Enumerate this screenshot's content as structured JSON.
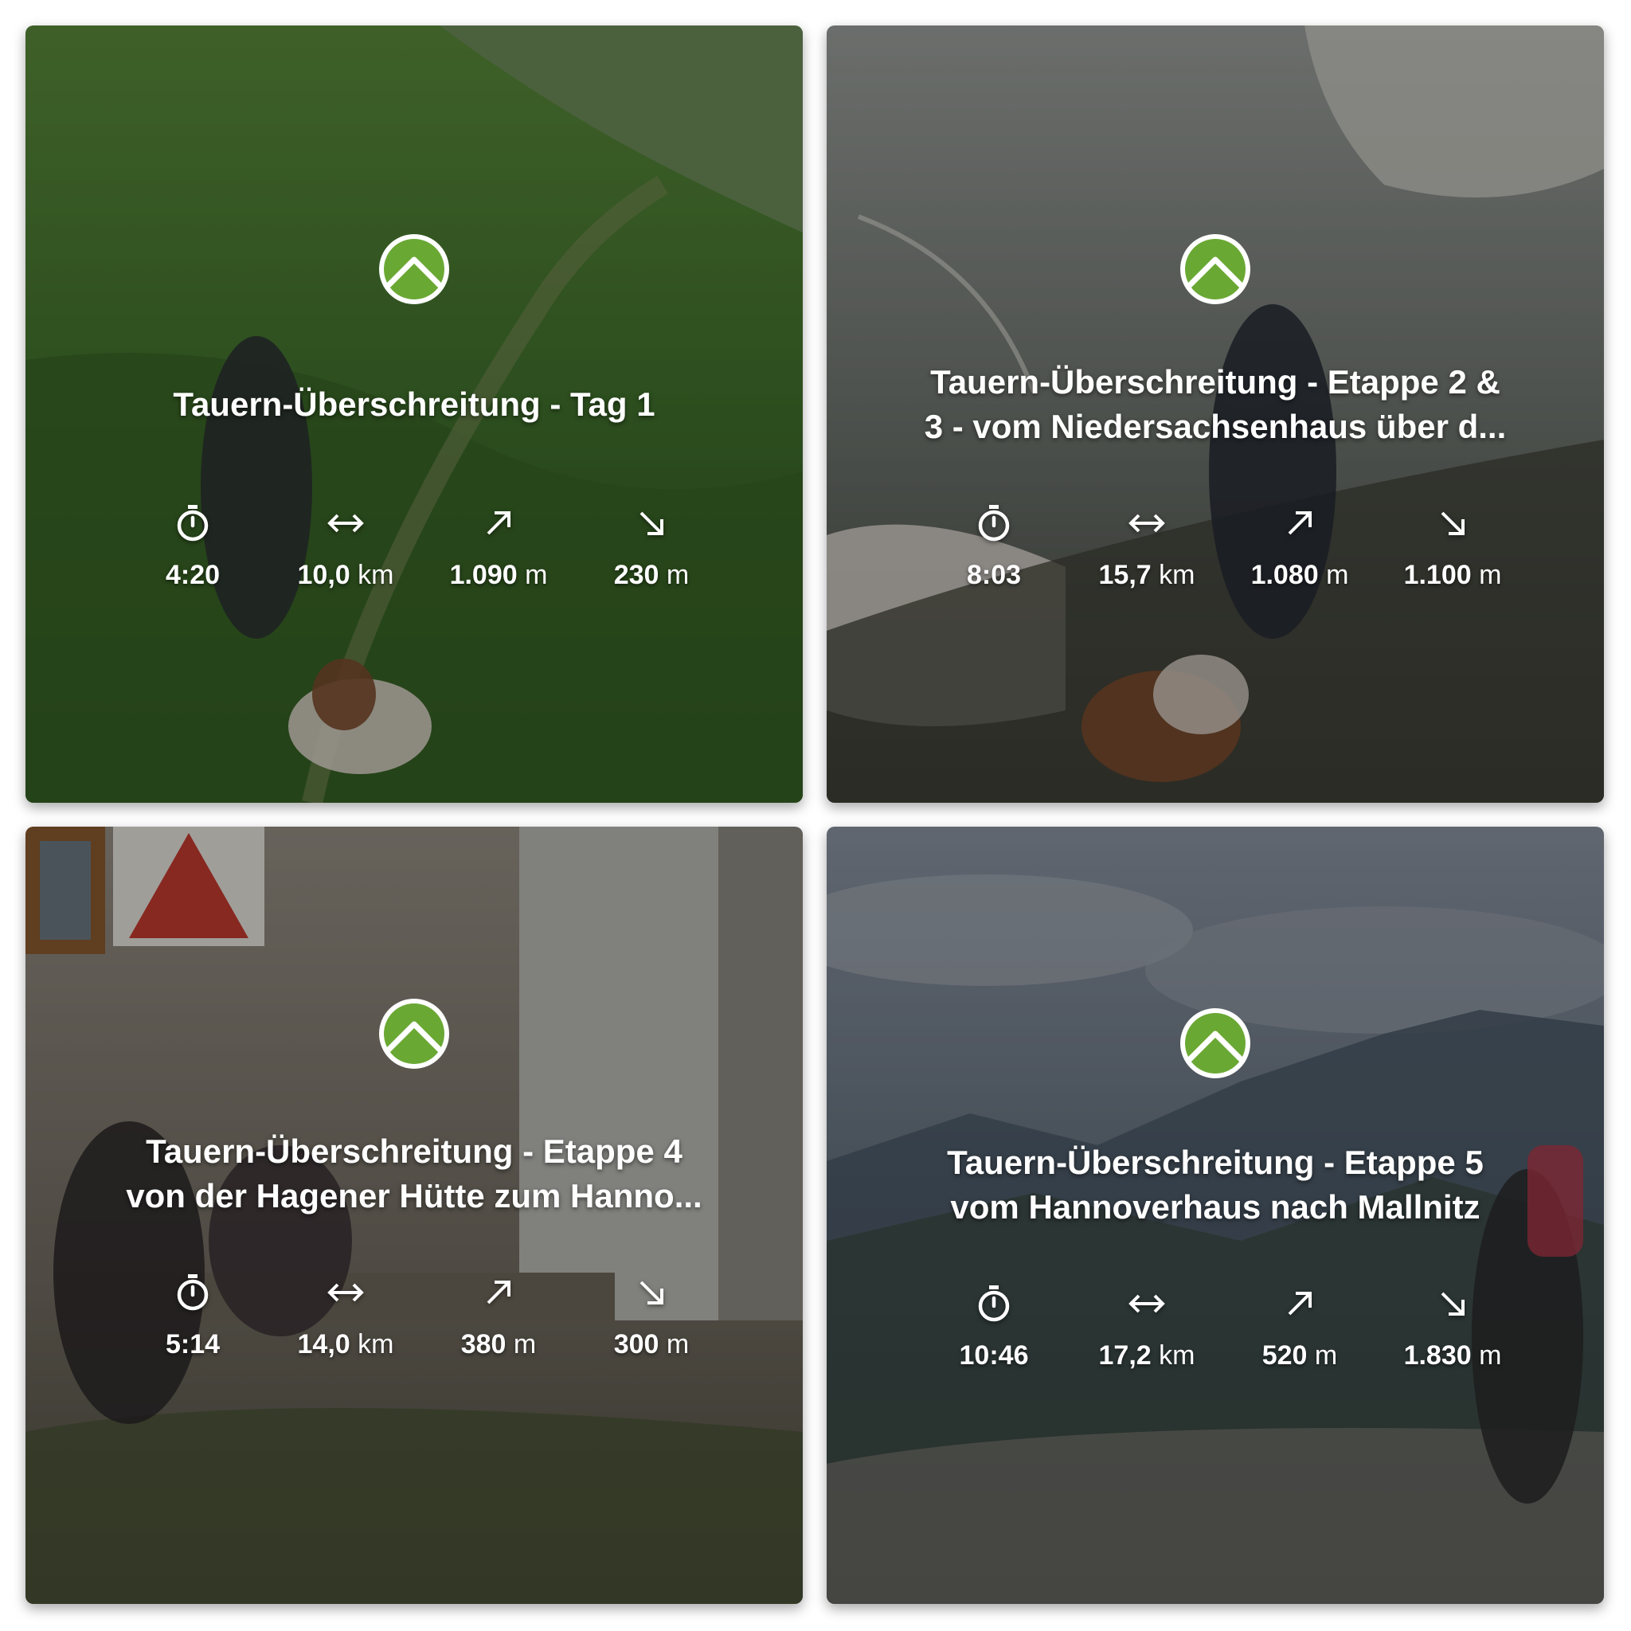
{
  "cards": [
    {
      "title_lines": [
        "Tauern-Überschreitung - Tag 1"
      ],
      "stats": {
        "duration": "4:20",
        "distance": "10,0",
        "distance_unit": "km",
        "ascent": "1.090",
        "ascent_unit": "m",
        "descent": "230",
        "descent_unit": "m"
      },
      "photo_theme": "green meadow trail with hiker and dog",
      "colors": {
        "top": "#4f7a34",
        "mid": "#3f6b2c",
        "bottom": "#2f5523"
      }
    },
    {
      "title_lines": [
        "Tauern-Überschreitung - Etappe 2 &",
        "3 - vom Niedersachsenhaus über d..."
      ],
      "stats": {
        "duration": "8:03",
        "distance": "15,7",
        "distance_unit": "km",
        "ascent": "1.080",
        "ascent_unit": "m",
        "descent": "1.100",
        "descent_unit": "m"
      },
      "photo_theme": "rocky alpine valley with hiker and dog",
      "colors": {
        "top": "#8a8f8c",
        "mid": "#5f6560",
        "bottom": "#3d4038"
      }
    },
    {
      "title_lines": [
        "Tauern-Überschreitung - Etappe 4",
        "von der Hagener Hütte zum Hanno..."
      ],
      "stats": {
        "duration": "5:14",
        "distance": "14,0",
        "distance_unit": "km",
        "ascent": "380",
        "ascent_unit": "m",
        "descent": "300",
        "descent_unit": "m"
      },
      "photo_theme": "hiker resting on bench at stone hut",
      "colors": {
        "top": "#8c8579",
        "mid": "#6b655c",
        "bottom": "#4a4a3c"
      }
    },
    {
      "title_lines": [
        "Tauern-Überschreitung - Etappe 5",
        "vom Hannoverhaus nach Mallnitz"
      ],
      "stats": {
        "duration": "10:46",
        "distance": "17,2",
        "distance_unit": "km",
        "ascent": "520",
        "ascent_unit": "m",
        "descent": "1.830",
        "descent_unit": "m"
      },
      "photo_theme": "cloudy mountain panorama with hiker",
      "colors": {
        "top": "#7d8694",
        "mid": "#4c5866",
        "bottom": "#3a3f3a"
      }
    }
  ],
  "icons": {
    "logo": "komoot-logo-icon",
    "duration": "stopwatch-icon",
    "distance": "horizontal-arrows-icon",
    "ascent": "arrow-up-right-icon",
    "descent": "arrow-down-right-icon"
  },
  "brand_color": "#6aa834"
}
